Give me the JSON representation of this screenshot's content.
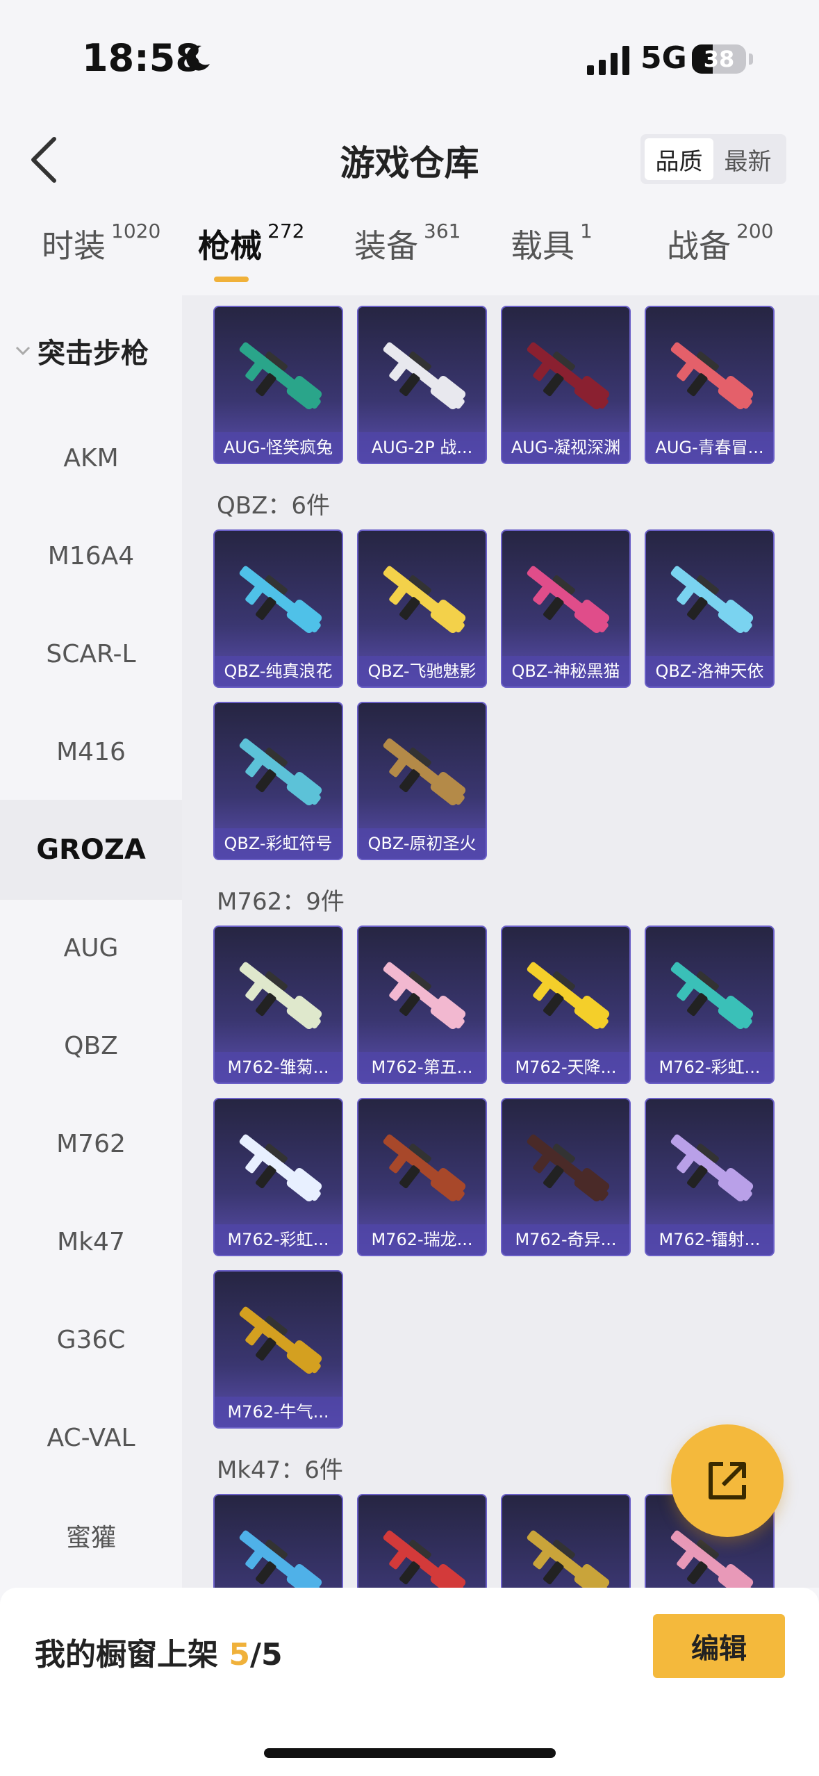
{
  "status_bar": {
    "time": "18:58",
    "network": "5G",
    "battery": "38",
    "battery_level": 0.38
  },
  "header": {
    "title": "游戏仓库",
    "sort_options": [
      "品质",
      "最新"
    ],
    "active_sort": 0
  },
  "tabs": [
    {
      "label": "时装",
      "count": "1020"
    },
    {
      "label": "枪械",
      "count": "272"
    },
    {
      "label": "装备",
      "count": "361"
    },
    {
      "label": "载具",
      "count": "1"
    },
    {
      "label": "战备",
      "count": "200"
    }
  ],
  "active_tab": 1,
  "sidebar": {
    "category": "突击步枪",
    "items": [
      "AKM",
      "M16A4",
      "SCAR-L",
      "M416",
      "GROZA",
      "AUG",
      "QBZ",
      "M762",
      "Mk47",
      "G36C",
      "AC-VAL",
      "蜜獾"
    ],
    "active_index": 4
  },
  "sections": [
    {
      "title": "",
      "items": [
        "AUG-怪笑疯兔",
        "AUG-2P 战...",
        "AUG-凝视深渊",
        "AUG-青春冒..."
      ],
      "gun_colors": [
        "#2aa58a",
        "#e8e8ee",
        "#8a2030",
        "#e4606a"
      ]
    },
    {
      "title": "QBZ：6件",
      "items": [
        "QBZ-纯真浪花",
        "QBZ-飞驰魅影",
        "QBZ-神秘黑猫",
        "QBZ-洛神天依",
        "QBZ-彩虹符号",
        "QBZ-原初圣火"
      ],
      "gun_colors": [
        "#4fc1e8",
        "#f3d14a",
        "#e04d8a",
        "#7ad3f0",
        "#5cc2d8",
        "#b48a48"
      ]
    },
    {
      "title": "M762：9件",
      "items": [
        "M762-雏菊...",
        "M762-第五...",
        "M762-天降...",
        "M762-彩虹...",
        "M762-彩虹...",
        "M762-瑞龙...",
        "M762-奇异...",
        "M762-镭射...",
        "M762-牛气..."
      ],
      "gun_colors": [
        "#dfe8cc",
        "#f2b8d0",
        "#f4cf2a",
        "#3ac0b8",
        "#e8f0ff",
        "#a8482a",
        "#4a2a28",
        "#b9a0e8",
        "#d4a020"
      ]
    },
    {
      "title": "Mk47：6件",
      "items": [
        "",
        "",
        "",
        ""
      ],
      "gun_colors": [
        "#4fb1e8",
        "#d33a3a",
        "#c9a43a",
        "#e899b8"
      ]
    }
  ],
  "fab": {
    "icon": "share-icon"
  },
  "bottom_bar": {
    "label": "我的橱窗上架 ",
    "current": "5",
    "separator": "/",
    "total": "5",
    "edit_label": "编辑"
  },
  "colors": {
    "accent": "#f4b93c",
    "card_purple": "#5b4fb0"
  }
}
